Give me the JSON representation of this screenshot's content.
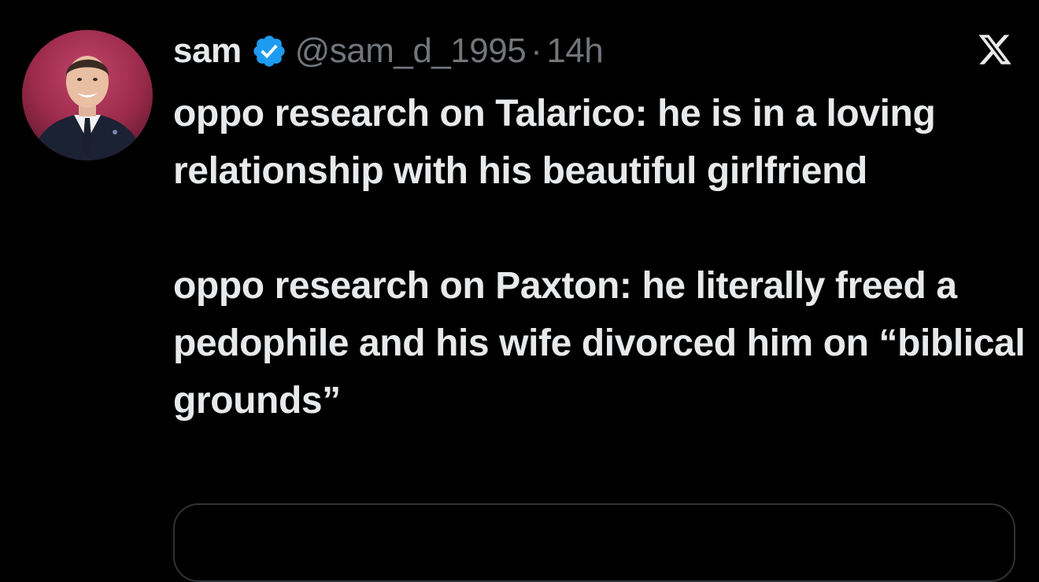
{
  "tweet": {
    "author": {
      "display_name": "sam",
      "verified_icon": "verified-badge-icon",
      "handle": "@sam_d_1995",
      "separator": "·",
      "timestamp": "14h",
      "avatar": "profile-photo"
    },
    "platform_logo": "x-logo-icon",
    "paragraphs": [
      "oppo research on Talarico: he is in a loving relationship with his beautiful girlfriend",
      "oppo research on Paxton: he literally freed a pedophile and his wife divorced him on “biblical grounds”"
    ],
    "colors": {
      "background": "#000000",
      "text": "#e7e9ea",
      "secondary_text": "#71767b",
      "verified_blue": "#1d9bf0",
      "card_border": "#2f3336"
    }
  }
}
